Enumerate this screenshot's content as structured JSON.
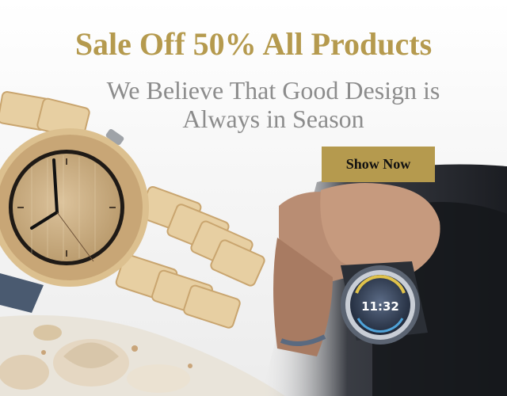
{
  "banner": {
    "headline": "Sale Off 50% All Products",
    "subline_1": "We Believe That Good Design is",
    "subline_2": "Always in Season",
    "cta_label": "Show Now",
    "smartwatch_display": "11:32"
  },
  "colors": {
    "accent_gold": "#b59a4e",
    "subline_gray": "#8c8c8c",
    "button_bg": "#b59a4e",
    "button_text": "#111111"
  },
  "icons": [
    "wooden-watch-image",
    "smartwatch-image",
    "seashell-decoration"
  ]
}
